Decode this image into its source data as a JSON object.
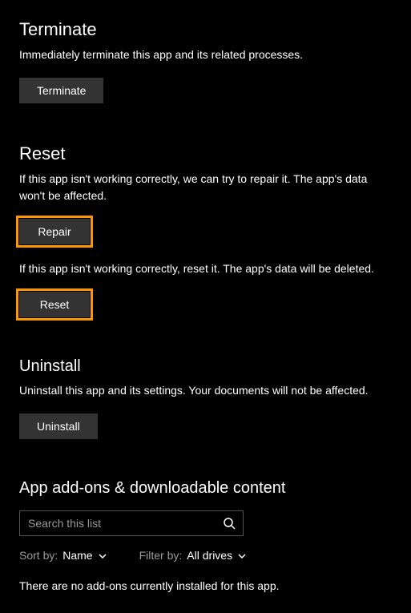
{
  "terminate": {
    "title": "Terminate",
    "desc": "Immediately terminate this app and its related processes.",
    "button": "Terminate"
  },
  "reset": {
    "title": "Reset",
    "repair_desc": "If this app isn't working correctly, we can try to repair it. The app's data won't be affected.",
    "repair_button": "Repair",
    "reset_desc": "If this app isn't working correctly, reset it. The app's data will be deleted.",
    "reset_button": "Reset"
  },
  "uninstall": {
    "title": "Uninstall",
    "desc": "Uninstall this app and its settings. Your documents will not be affected.",
    "button": "Uninstall"
  },
  "addons": {
    "title": "App add-ons & downloadable content",
    "search_placeholder": "Search this list",
    "sort_label": "Sort by:",
    "sort_value": "Name",
    "filter_label": "Filter by:",
    "filter_value": "All drives",
    "empty": "There are no add-ons currently installed for this app."
  }
}
